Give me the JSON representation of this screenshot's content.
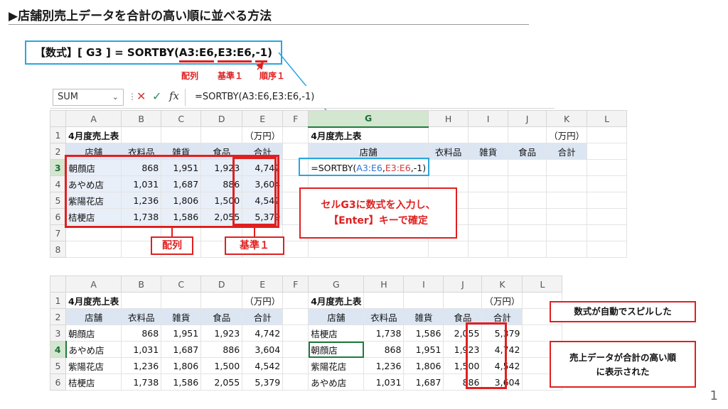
{
  "slide": {
    "title": "▶店舗別売上データを合計の高い順に並べる方法",
    "page_number": "1"
  },
  "formula_box": {
    "prefix": "【数式】[ G3 ] = SORTBY(",
    "arg1": "A3:E6",
    "comma1": ",",
    "arg2": "E3:E6",
    "comma2": ",",
    "arg3": "-1",
    "suffix": ")"
  },
  "arg_labels": {
    "array": "配列",
    "by1": "基準１",
    "order1": "順序１"
  },
  "formula_bar": {
    "name_box": "SUM",
    "caret": "⌄",
    "dots": "⋮",
    "cancel": "✕",
    "enter": "✓",
    "fx": "fx",
    "content": "=SORTBY(A3:E6,E3:E6,-1)"
  },
  "columns": [
    "A",
    "B",
    "C",
    "D",
    "E",
    "F",
    "G",
    "H",
    "I",
    "J",
    "K",
    "L"
  ],
  "rows_top": [
    "1",
    "2",
    "3",
    "4",
    "5",
    "6",
    "7",
    "8"
  ],
  "rows_bottom": [
    "1",
    "2",
    "3",
    "4",
    "5",
    "6"
  ],
  "table_title": "4月度売上表",
  "unit": "（万円）",
  "headers": [
    "店舗",
    "衣料品",
    "雑貨",
    "食品",
    "合計"
  ],
  "source_rows": [
    [
      "朝顔店",
      "868",
      "1,951",
      "1,923",
      "4,742"
    ],
    [
      "あやめ店",
      "1,031",
      "1,687",
      "886",
      "3,604"
    ],
    [
      "紫陽花店",
      "1,236",
      "1,806",
      "1,500",
      "4,542"
    ],
    [
      "桔梗店",
      "1,738",
      "1,586",
      "2,055",
      "5,379"
    ]
  ],
  "sorted_rows": [
    [
      "桔梗店",
      "1,738",
      "1,586",
      "2,055",
      "5,379"
    ],
    [
      "朝顔店",
      "868",
      "1,951",
      "1,923",
      "4,742"
    ],
    [
      "紫陽花店",
      "1,236",
      "1,806",
      "1,500",
      "4,542"
    ],
    [
      "あやめ店",
      "1,031",
      "1,687",
      "886",
      "3,604"
    ]
  ],
  "editing_cell": {
    "prefix": "=SORTBY(",
    "arg1": "A3:E6",
    "comma1": ",",
    "arg2": "E3:E6",
    "rest": ",-1)"
  },
  "callouts": {
    "array": "配列",
    "by1": "基準１",
    "instruction_line1": "セルG3に数式を入力し、",
    "instruction_line2": "【Enter】キーで確定",
    "spilled": "数式が自動でスピルした",
    "sorted_line1": "売上データが合計の高い順",
    "sorted_line2": "に表示された"
  },
  "colors": {
    "accent_red": "#e02020",
    "accent_blue": "#29a6e0",
    "excel_green": "#1f7a3d"
  }
}
